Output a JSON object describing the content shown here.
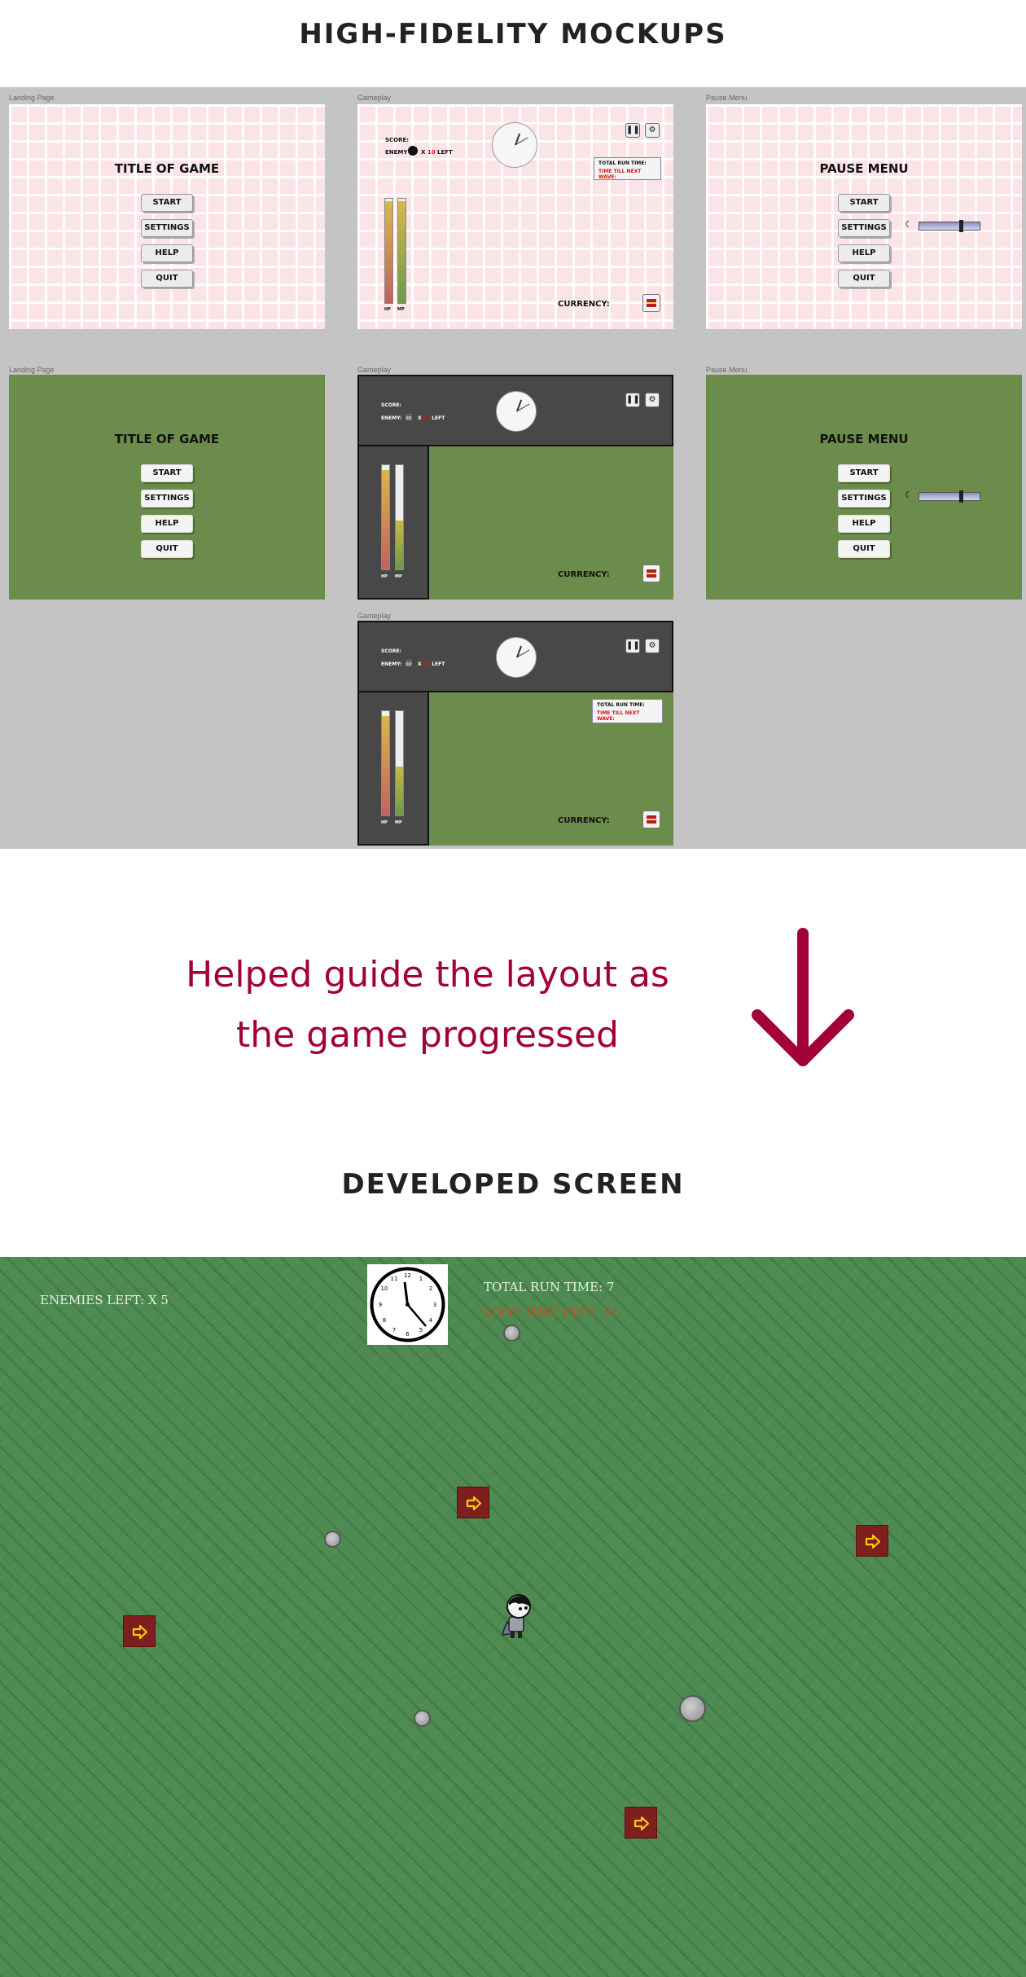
{
  "headings": {
    "mockups": "HIGH-FIDELITY MOCKUPS",
    "developed": "DEVELOPED SCREEN"
  },
  "caption": {
    "line1": "Helped guide the layout as",
    "line2": "the game progressed"
  },
  "frame_labels": {
    "landing": "Landing Page",
    "gameplay": "Gameplay",
    "pause": "Pause Menu"
  },
  "landing": {
    "title": "TITLE OF GAME",
    "buttons": [
      "START",
      "SETTINGS",
      "HELP",
      "QUIT"
    ]
  },
  "pause": {
    "title": "PAUSE MENU",
    "buttons": [
      "START",
      "SETTINGS",
      "HELP",
      "QUIT"
    ],
    "volume_fraction": 0.66
  },
  "gameplay_mock": {
    "score_label": "SCORE:",
    "enemy_label": "ENEMY:",
    "enemy_label_v1": "ENEMY",
    "enemy_count_prefix": "X",
    "enemy_count": "10",
    "enemy_suffix": "LEFT",
    "currency_label": "CURRENCY:",
    "hp_label": "HP",
    "mp_label": "MP",
    "hp_fraction": 0.98,
    "mp_fraction": 0.98,
    "hp_fraction_v2": 0.95,
    "mp_fraction_v2": 0.47,
    "total_run_time_label": "TOTAL RUN TIME:",
    "time_till_next_wave_label": "TIME TILL NEXT WAVE:",
    "pause_icon": "pause-icon",
    "settings_icon": "gear-icon",
    "currency_icon": "chest-icon"
  },
  "game": {
    "enemies_left": "ENEMIES LEFT: X 5",
    "total_run_time": "TOTAL RUN TIME: 7",
    "loot_time_left": "LOOT TIME LEFT: 51",
    "clock_icon": "clock-icon",
    "arrow_icon": "arrow-right-icon",
    "rock_icon": "rock-icon",
    "player_icon": "player-character-icon"
  },
  "colors": {
    "caption": "#a3003a",
    "mock_green": "#6b8c4a",
    "mock_pink": "#fbe4e7",
    "game_grass": "#4e8a52",
    "loot_red": "#d24a1a"
  }
}
